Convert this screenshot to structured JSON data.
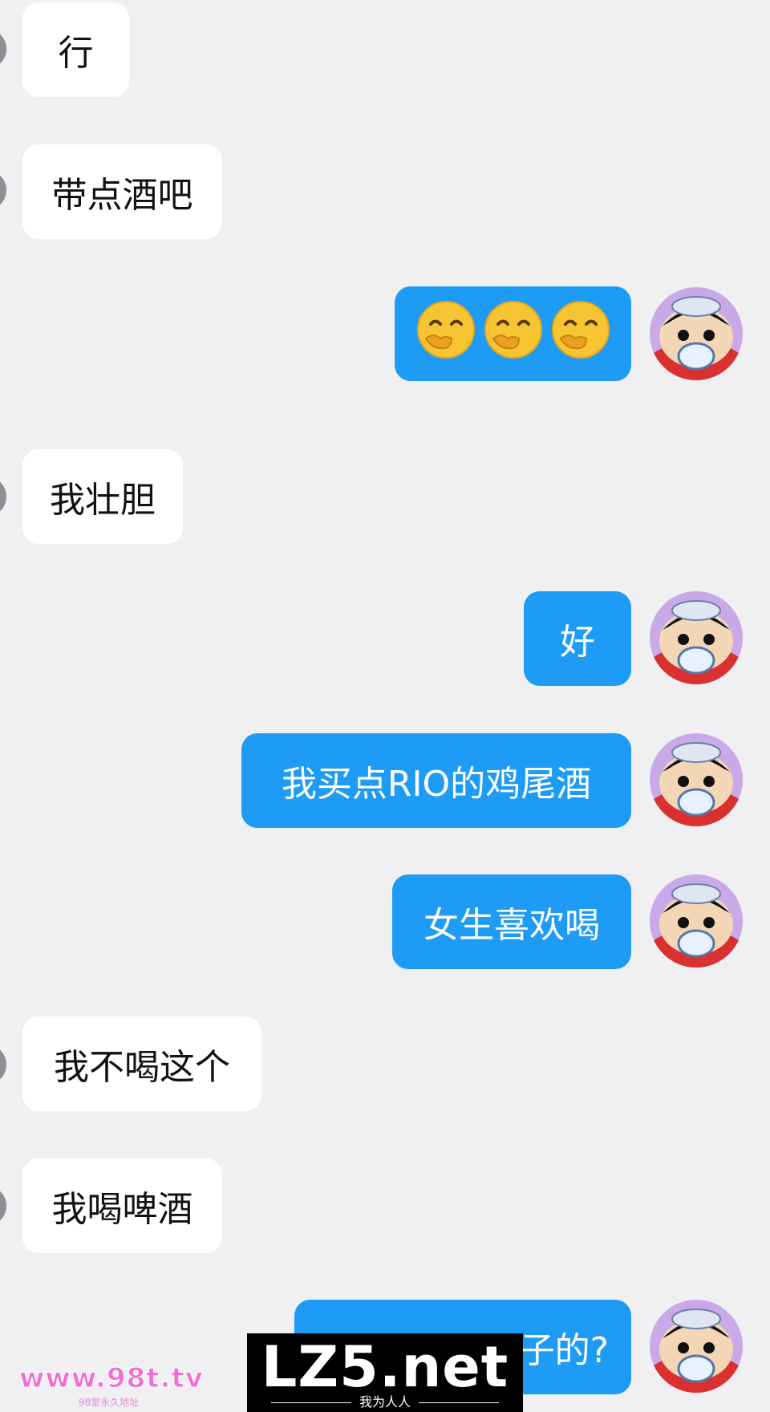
{
  "messages": [
    {
      "side": "in",
      "text": "行"
    },
    {
      "side": "in",
      "text": "带点酒吧"
    },
    {
      "side": "out",
      "emoji": "face-with-hand-over-mouth",
      "count": 3
    },
    {
      "side": "in",
      "text": "我壮胆"
    },
    {
      "side": "out",
      "text": "好"
    },
    {
      "side": "out",
      "text": "我买点RIO的鸡尾酒"
    },
    {
      "side": "out",
      "text": "女生喜欢喝"
    },
    {
      "side": "in",
      "text": "我不喝这个"
    },
    {
      "side": "in",
      "text": "我喝啤酒"
    },
    {
      "side": "out",
      "text": "…子的?"
    }
  ],
  "watermark": {
    "site_left": "www.98t.tv",
    "site_left_sub": "98堂永久地址",
    "box_title": "LZ5.net",
    "box_sub": "我为人人"
  },
  "colors": {
    "background": "#f0f0f2",
    "incoming_bubble": "#ffffff",
    "outgoing_bubble": "#1e9bf5"
  }
}
